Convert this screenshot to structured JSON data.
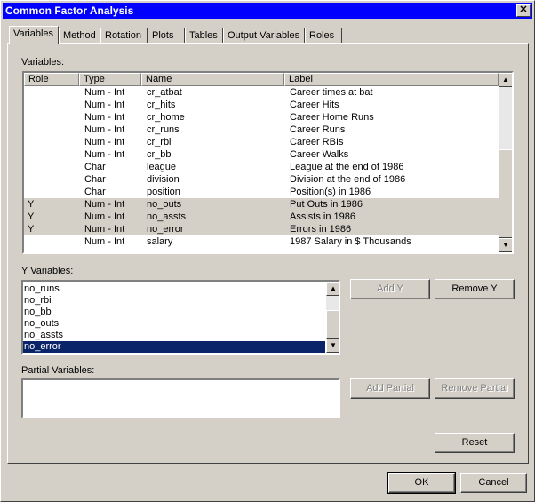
{
  "window": {
    "title": "Common Factor Analysis",
    "close": "✕"
  },
  "tabs": [
    "Variables",
    "Method",
    "Rotation",
    "Plots",
    "Tables",
    "Output Variables",
    "Roles"
  ],
  "variables": {
    "label": "Variables:",
    "columns": [
      "Role",
      "Type",
      "Name",
      "Label"
    ],
    "rows": [
      {
        "role": "",
        "type": "Num - Int",
        "name": "cr_atbat",
        "label": "Career times at bat"
      },
      {
        "role": "",
        "type": "Num - Int",
        "name": "cr_hits",
        "label": "Career Hits"
      },
      {
        "role": "",
        "type": "Num - Int",
        "name": "cr_home",
        "label": "Career Home Runs"
      },
      {
        "role": "",
        "type": "Num - Int",
        "name": "cr_runs",
        "label": "Career Runs"
      },
      {
        "role": "",
        "type": "Num - Int",
        "name": "cr_rbi",
        "label": "Career RBIs"
      },
      {
        "role": "",
        "type": "Num - Int",
        "name": "cr_bb",
        "label": "Career Walks"
      },
      {
        "role": "",
        "type": "Char",
        "name": "league",
        "label": "League at the end of 1986"
      },
      {
        "role": "",
        "type": "Char",
        "name": "division",
        "label": "Division at the end of 1986"
      },
      {
        "role": "",
        "type": "Char",
        "name": "position",
        "label": "Position(s) in 1986"
      },
      {
        "role": "Y",
        "type": "Num - Int",
        "name": "no_outs",
        "label": "Put Outs in 1986"
      },
      {
        "role": "Y",
        "type": "Num - Int",
        "name": "no_assts",
        "label": "Assists in 1986"
      },
      {
        "role": "Y",
        "type": "Num - Int",
        "name": "no_error",
        "label": "Errors in 1986"
      },
      {
        "role": "",
        "type": "Num - Int",
        "name": "salary",
        "label": "1987 Salary in $ Thousands"
      }
    ]
  },
  "y_variables": {
    "label": "Y Variables:",
    "items": [
      "no_runs",
      "no_rbi",
      "no_bb",
      "no_outs",
      "no_assts",
      "no_error"
    ],
    "selected": "no_error"
  },
  "partial_variables": {
    "label": "Partial Variables:",
    "items": []
  },
  "buttons": {
    "add_y": "Add Y",
    "remove_y": "Remove Y",
    "add_partial": "Add Partial",
    "remove_partial": "Remove Partial",
    "reset": "Reset",
    "ok": "OK",
    "cancel": "Cancel"
  },
  "colors": {
    "title_bar": "#0000ff",
    "selection": "#0a246a",
    "face": "#d4d0c8"
  }
}
